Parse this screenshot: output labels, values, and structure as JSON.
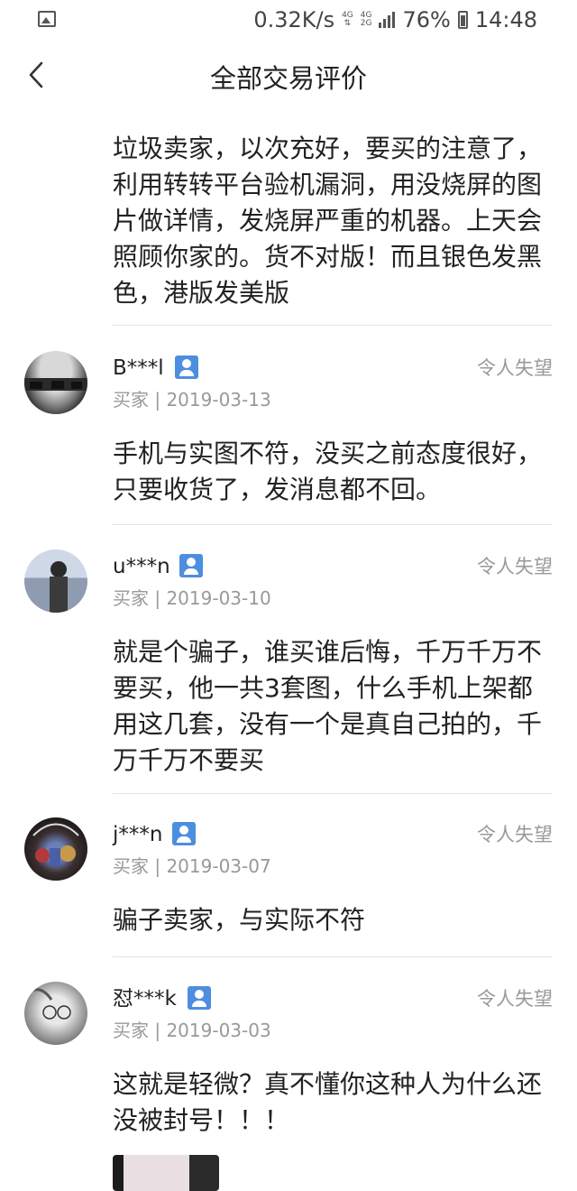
{
  "status_bar": {
    "speed": "0.32K/s",
    "net_top": "4G",
    "net_dual": "4G\n2G",
    "battery": "76%",
    "time": "14:48"
  },
  "nav": {
    "title": "全部交易评价"
  },
  "first_comment": "垃圾卖家，以次充好，要买的注意了，利用转转平台验机漏洞，用没烧屏的图片做详情，发烧屏严重的机器。上天会照顾你家的。货不对版！而且银色发黑色，港版发美版",
  "reviews": [
    {
      "user": "B***l",
      "meta": "买家 | 2019-03-13",
      "rating": "令人失望",
      "comment": "手机与实图不符，没买之前态度很好，只要收货了，发消息都不回。"
    },
    {
      "user": "u***n",
      "meta": "买家 | 2019-03-10",
      "rating": "令人失望",
      "comment": "就是个骗子，谁买谁后悔，千万千万不要买，他一共3套图，什么手机上架都用这几套，没有一个是真自己拍的，千万千万不要买"
    },
    {
      "user": "j***n",
      "meta": "买家 | 2019-03-07",
      "rating": "令人失望",
      "comment": "骗子卖家，与实际不符"
    },
    {
      "user": "怼***k",
      "meta": "买家 | 2019-03-03",
      "rating": "令人失望",
      "comment": "这就是轻微？真不懂你这种人为什么还没被封号！！！"
    }
  ]
}
